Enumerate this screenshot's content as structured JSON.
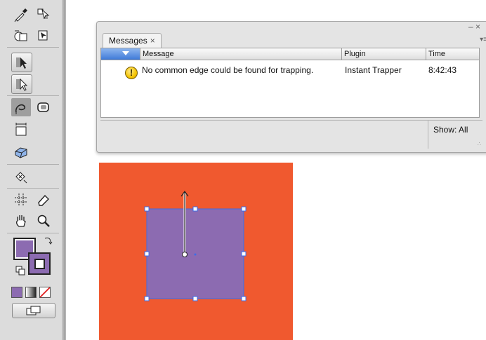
{
  "toolbar": {
    "tools": [
      "eyedropper-tool",
      "live-paint-selection-tool",
      "shape-builder-tool",
      "live-paint-bucket-tool",
      "selection-tool",
      "direct-selection-tool",
      "lasso-tool",
      "rounded-rectangle-tool",
      "artboard-tool",
      "perspective-grid-tool",
      "symbol-sprayer-tool",
      "slice-tool",
      "eraser-tool",
      "hand-tool",
      "zoom-tool"
    ],
    "fill_color": "#8c6bb1",
    "stroke_color": "#8c6bb1"
  },
  "messages_panel": {
    "tab_label": "Messages",
    "tab_close": "×",
    "columns": [
      "Message",
      "Plugin",
      "Time"
    ],
    "rows": [
      {
        "icon": "warning-icon",
        "message": "No common edge could be found for trapping.",
        "plugin": "Instant Trapper",
        "time": "8:42:43"
      }
    ],
    "filter_label": "Show: All"
  },
  "artwork": {
    "background_color": "#f0592f",
    "shape_color": "#8c6bb1",
    "selection_color": "#3d6de8"
  }
}
